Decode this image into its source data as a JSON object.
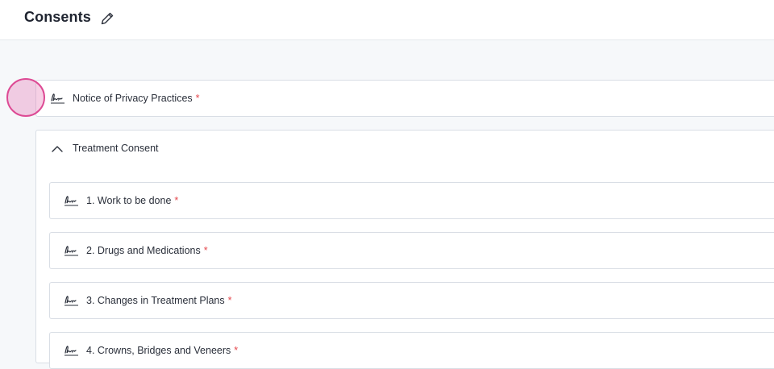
{
  "header": {
    "title": "Consents",
    "edit_icon": "pencil-icon"
  },
  "consents": {
    "privacy": {
      "label": "Notice of Privacy Practices",
      "required_mark": "*",
      "icon": "signature-icon"
    },
    "treatment": {
      "label": "Treatment Consent",
      "expanded": true,
      "icon": "chevron-up-icon",
      "items": [
        {
          "label": "1. Work to be done",
          "required_mark": "*"
        },
        {
          "label": "2. Drugs and Medications",
          "required_mark": "*"
        },
        {
          "label": "3. Changes in Treatment Plans",
          "required_mark": "*"
        },
        {
          "label": "4. Crowns, Bridges and Veneers",
          "required_mark": "*"
        }
      ]
    }
  },
  "colors": {
    "required": "#e5484d",
    "cursor_highlight": "#dd4a94",
    "background": "#f6f8fa"
  }
}
